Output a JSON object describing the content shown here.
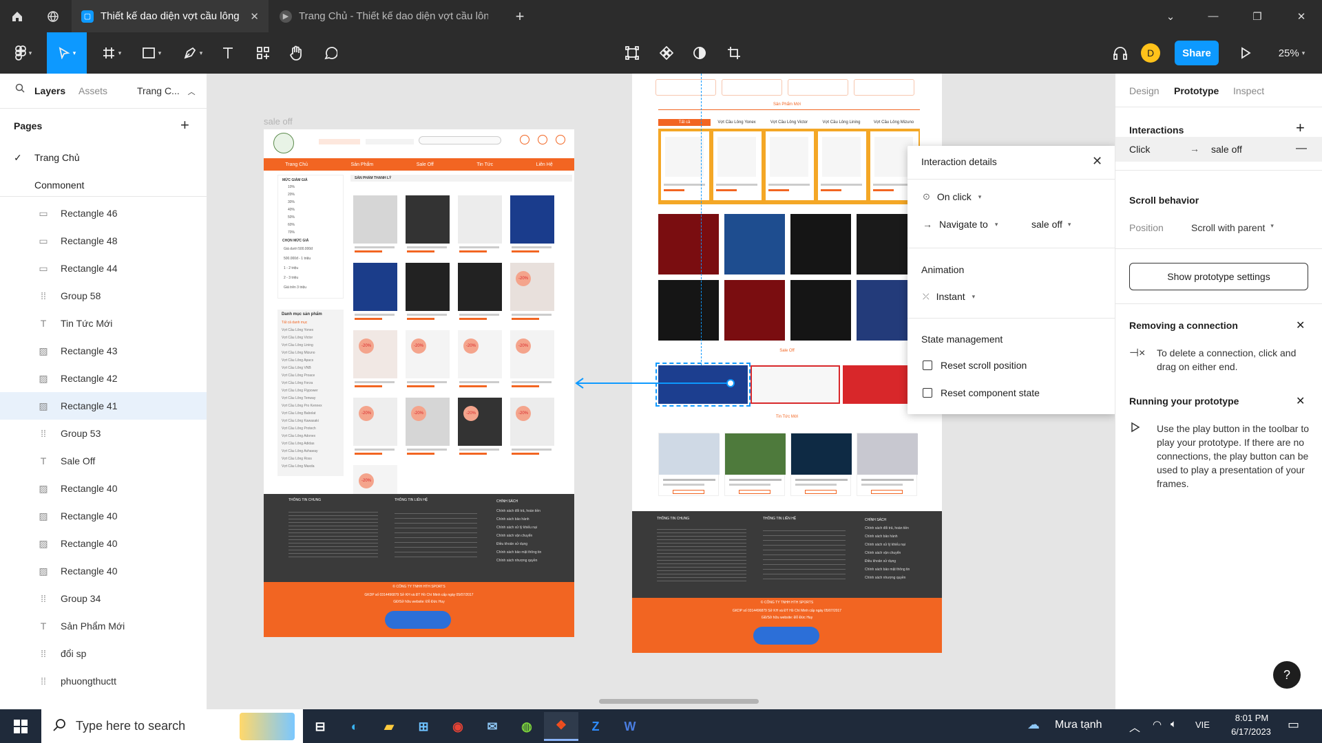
{
  "tabs": [
    {
      "label": "Thiết kế dao diện vợt cầu lông",
      "active": true
    },
    {
      "label": "Trang Chủ - Thiết kế dao diện vợt cầu lông",
      "active": false
    }
  ],
  "toolbar": {
    "share_label": "Share",
    "avatar_initial": "D",
    "zoom": "25%"
  },
  "left_panel": {
    "tabs": [
      "Layers",
      "Assets"
    ],
    "page_dropdown": "Trang C...",
    "pages_title": "Pages",
    "pages": [
      "Trang Chủ",
      "Conmonent"
    ],
    "layers": [
      {
        "icon": "rectangle-icon",
        "name": "Rectangle 46"
      },
      {
        "icon": "rectangle-icon",
        "name": "Rectangle 48"
      },
      {
        "icon": "rectangle-icon",
        "name": "Rectangle 44"
      },
      {
        "icon": "group-icon",
        "name": "Group 58"
      },
      {
        "icon": "text-icon",
        "name": "Tin Tức Mới"
      },
      {
        "icon": "image-icon",
        "name": "Rectangle 43"
      },
      {
        "icon": "image-icon",
        "name": "Rectangle 42"
      },
      {
        "icon": "image-icon",
        "name": "Rectangle 41",
        "selected": true
      },
      {
        "icon": "group-icon",
        "name": "Group 53"
      },
      {
        "icon": "text-icon",
        "name": "Sale Off"
      },
      {
        "icon": "image-icon",
        "name": "Rectangle 40"
      },
      {
        "icon": "image-icon",
        "name": "Rectangle 40"
      },
      {
        "icon": "image-icon",
        "name": "Rectangle 40"
      },
      {
        "icon": "image-icon",
        "name": "Rectangle 40"
      },
      {
        "icon": "group-icon",
        "name": "Group 34"
      },
      {
        "icon": "text-icon",
        "name": "Sản Phẩm Mới"
      },
      {
        "icon": "group-icon",
        "name": "đổi sp"
      },
      {
        "icon": "group-icon",
        "name": "phuongthuctt"
      }
    ]
  },
  "canvas": {
    "frame_label": "sale off",
    "site": {
      "nav": [
        "Trang Chủ",
        "Sản Phẩm",
        "Sale Off",
        "Tin Tức",
        "Liên Hệ"
      ],
      "section_liquidation": "SẢN PHẨM THANH LÝ",
      "filter_title": "MỨC GIẢM GIÁ",
      "filter_items": [
        "10%",
        "20%",
        "30%",
        "40%",
        "50%",
        "60%",
        "70%"
      ],
      "price_title": "CHỌN MỨC GIÁ",
      "price_items": [
        "Giá dưới 500.000đ",
        "500.000đ - 1 triệu",
        "1 - 2 triệu",
        "2 - 3 triệu",
        "Giá trên 3 triệu"
      ],
      "category_title": "Danh mục sản phẩm",
      "categories": [
        "Tất cả danh mục",
        "Vợt Cầu Lông Yonex",
        "Vợt Cầu Lông Victor",
        "Vợt Cầu Lông Lining",
        "Vợt Cầu Lông Mizuno",
        "Vợt Cầu Lông Apacs",
        "Vợt Cầu Lông VNB",
        "Vợt Cầu Lông Proace",
        "Vợt Cầu Lông Forza",
        "Vợt Cầu Lông Flypower",
        "Vợt Cầu Lông Tenway",
        "Vợt Cầu Lông Pro Kennex",
        "Vợt Cầu Lông Babolat",
        "Vợt Cầu Lông Kawasaki",
        "Vợt Cầu Lông Protech",
        "Vợt Cầu Lông Adonex",
        "Vợt Cầu Lông Adidas",
        "Vợt Cầu Lông Ashaway",
        "Vợt Cầu Lông Ross",
        "Vợt Cầu Lông Maxda"
      ],
      "footer_cols": [
        "THÔNG TIN CHUNG",
        "THÔNG TIN LIÊN HỆ",
        "CHÍNH SÁCH"
      ],
      "policies": [
        "Chính sách đổi trả, hoàn tiền",
        "Chính sách bảo hành",
        "Chính sách xử lý khiếu nại",
        "Chính sách vận chuyển",
        "Điều khoản sử dụng",
        "Chính sách bảo mật thông tin",
        "Chính sách nhượng quyền"
      ],
      "company": "© CÔNG TY TNHH HTH SPORTS",
      "gkdp": "GKDP số 0314496879 Sở KH và ĐT Hồ Chí Minh cấp ngày 05/07/2017",
      "owner": "GĐ/Sở hữu website: Đỗ Đức Huy",
      "home_new_products": "Sản Phẩm Mới",
      "home_sale_off": "Sale Off",
      "home_news": "Tin Tức Mới",
      "home_tabs": [
        "Tất cả",
        "Vợt Cầu Lông Yonex",
        "Vợt Cầu Lông Victor",
        "Vợt Cầu Lông Lining",
        "Vợt Cầu Lông Mizuno"
      ],
      "discount_badge": "-20%"
    }
  },
  "right_panel": {
    "tabs": [
      "Design",
      "Prototype",
      "Inspect"
    ],
    "interactions_title": "Interactions",
    "interaction_trigger": "Click",
    "interaction_target": "sale off",
    "scroll_title": "Scroll behavior",
    "position_label": "Position",
    "position_value": "Scroll with parent",
    "prototype_settings_btn": "Show prototype settings",
    "removing_title": "Removing a connection",
    "removing_text": "To delete a connection, click and drag on either end.",
    "running_title": "Running your prototype",
    "running_text": "Use the play button in the toolbar to play your prototype. If there are no connections, the play button can be used to play a presentation of your frames.",
    "help": "?"
  },
  "popup": {
    "title": "Interaction details",
    "trigger": "On click",
    "action": "Navigate to",
    "destination": "sale off",
    "animation_title": "Animation",
    "animation_value": "Instant",
    "state_title": "State management",
    "reset_scroll": "Reset scroll position",
    "reset_component": "Reset component state"
  },
  "taskbar": {
    "search_placeholder": "Type here to search",
    "weather": "Mưa tạnh",
    "lang": "VIE",
    "time": "8:01 PM",
    "date": "6/17/2023"
  },
  "colors": {
    "accent_blue": "#0d99ff",
    "site_orange": "#f26522",
    "site_dark": "#3a3a3a",
    "selection_bg": "#e8f1fb",
    "avatar": "#ffc21a"
  }
}
